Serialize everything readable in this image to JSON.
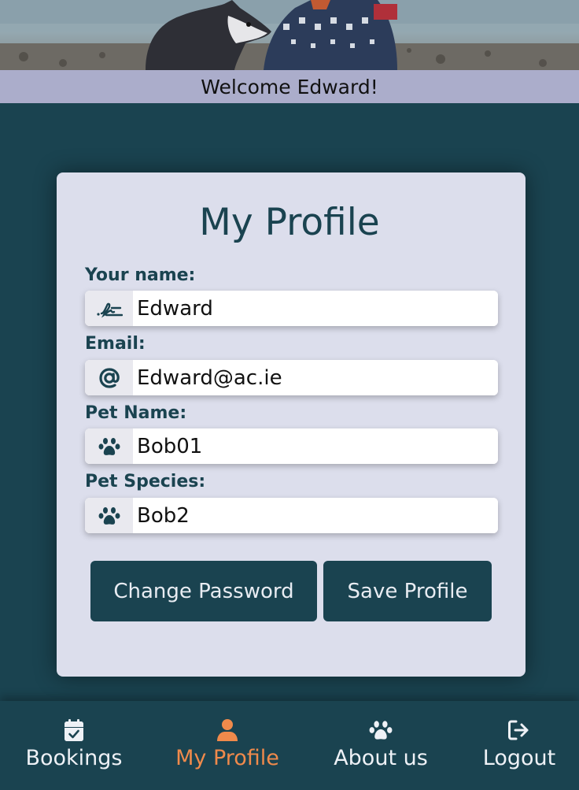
{
  "header": {
    "welcome_text": "Welcome Edward!"
  },
  "profile": {
    "title": "My Profile",
    "fields": [
      {
        "label": "Your name:",
        "value": "Edward",
        "icon": "signature-icon"
      },
      {
        "label": "Email:",
        "value": "Edward@ac.ie",
        "icon": "at-icon"
      },
      {
        "label": "Pet Name:",
        "value": "Bob01",
        "icon": "paw-icon"
      },
      {
        "label": "Pet Species:",
        "value": "Bob2",
        "icon": "paw-icon"
      }
    ],
    "buttons": {
      "change_password": "Change Password",
      "save_profile": "Save Profile"
    }
  },
  "nav": {
    "items": [
      {
        "label": "Bookings",
        "icon": "calendar-check-icon",
        "active": false
      },
      {
        "label": "My Profile",
        "icon": "user-icon",
        "active": true
      },
      {
        "label": "About us",
        "icon": "paw-icon",
        "active": false
      },
      {
        "label": "Logout",
        "icon": "logout-icon",
        "active": false
      }
    ]
  },
  "colors": {
    "background": "#1a4350",
    "welcome_bar": "#abadcb",
    "card": "#dcdeec",
    "accent_active": "#f08a4b"
  }
}
